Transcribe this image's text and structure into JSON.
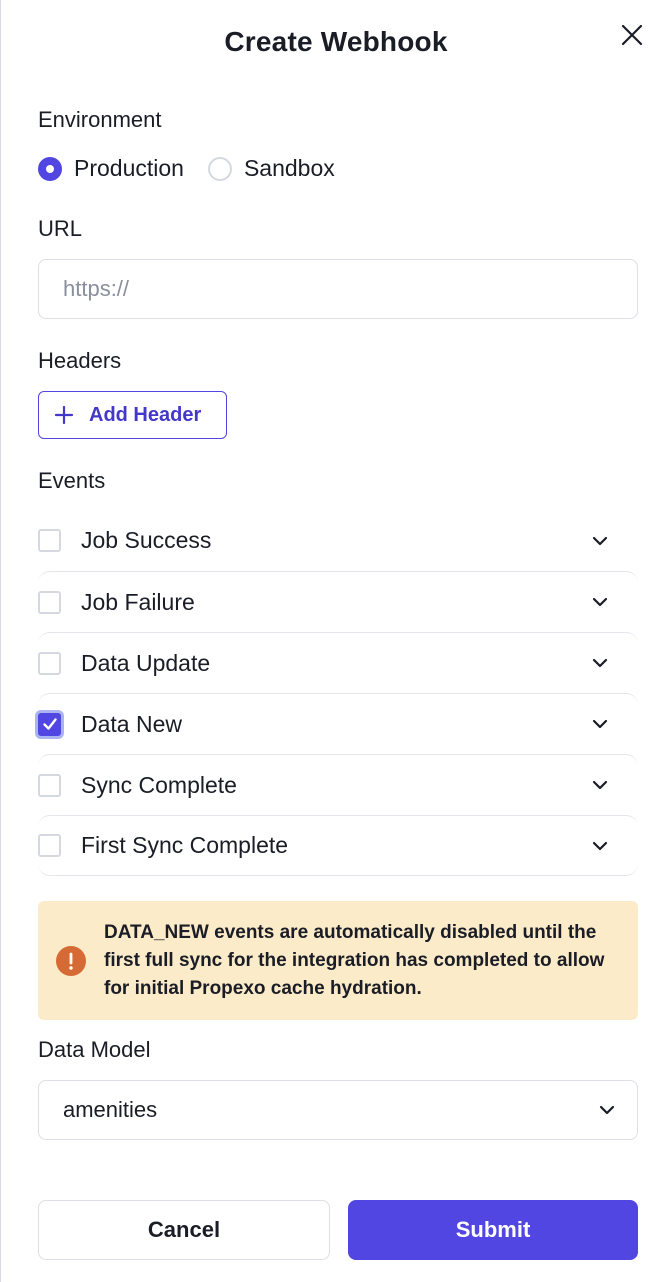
{
  "dialog": {
    "title": "Create Webhook"
  },
  "environment": {
    "label": "Environment",
    "options": [
      {
        "label": "Production",
        "selected": true
      },
      {
        "label": "Sandbox",
        "selected": false
      }
    ]
  },
  "url": {
    "label": "URL",
    "value": "",
    "placeholder": "https://"
  },
  "headers": {
    "label": "Headers",
    "add_button": "Add Header"
  },
  "events": {
    "label": "Events",
    "items": [
      {
        "label": "Job Success",
        "checked": false
      },
      {
        "label": "Job Failure",
        "checked": false
      },
      {
        "label": "Data Update",
        "checked": false
      },
      {
        "label": "Data New",
        "checked": true
      },
      {
        "label": "Sync Complete",
        "checked": false
      },
      {
        "label": "First Sync Complete",
        "checked": false
      }
    ]
  },
  "alert": {
    "text": "DATA_NEW events are automatically disabled until the first full sync for the integration has completed to allow for initial Propexo cache hydration."
  },
  "data_model": {
    "label": "Data Model",
    "value": "amenities"
  },
  "actions": {
    "cancel": "Cancel",
    "submit": "Submit"
  },
  "colors": {
    "accent": "#5146e1",
    "alert_bg": "#fcebc9",
    "alert_icon": "#d56a34"
  }
}
